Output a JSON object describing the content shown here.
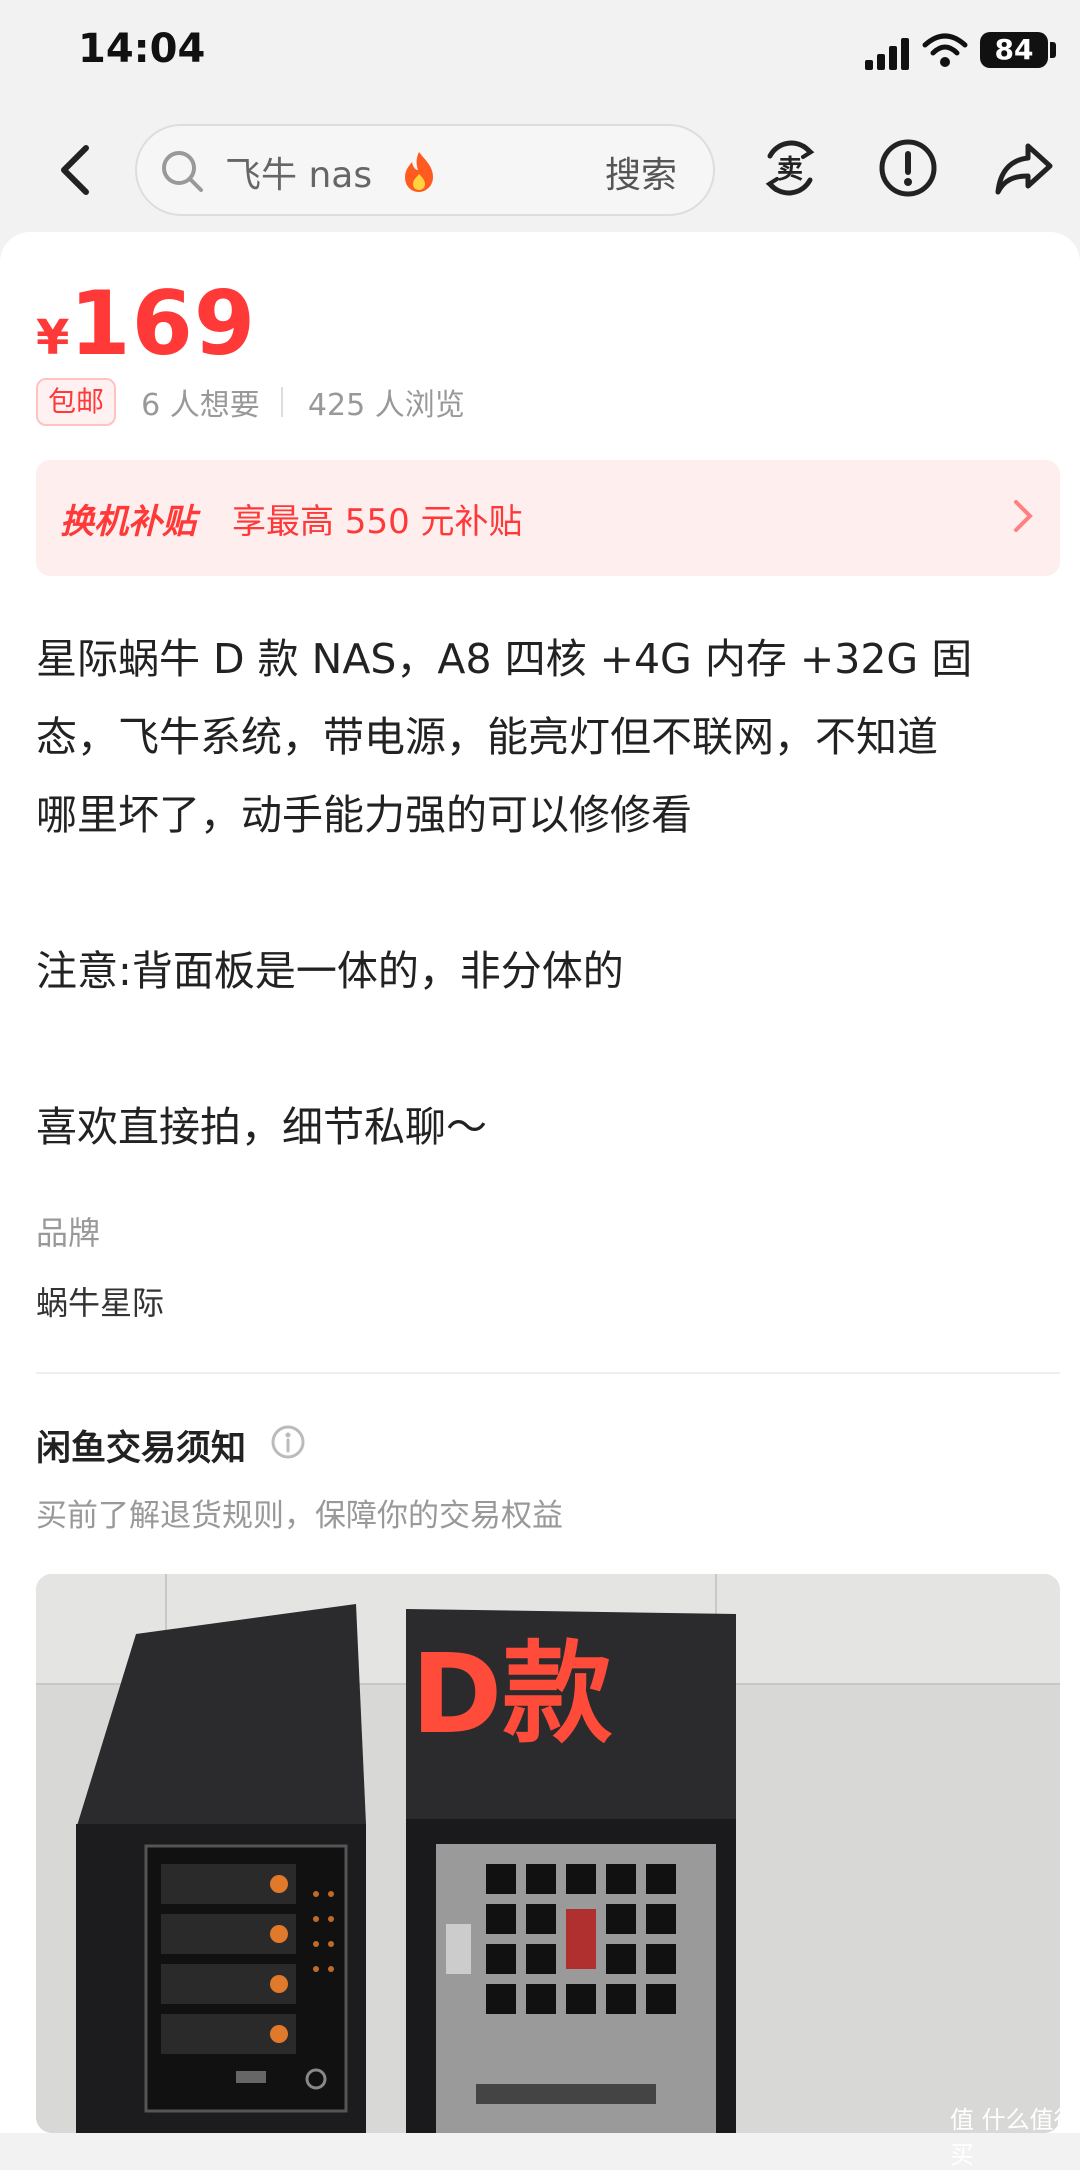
{
  "status_bar": {
    "time": "14:04",
    "battery": "84"
  },
  "nav": {
    "search_term": "飞牛 nas",
    "search_button": "搜索"
  },
  "price": {
    "symbol": "¥",
    "value": "169"
  },
  "meta": {
    "free_shipping": "包邮",
    "want": "6 人想要",
    "views": "425 人浏览"
  },
  "subsidy": {
    "title": "换机补贴",
    "text": "享最高 550 元补贴"
  },
  "description": "星际蜗牛 D 款 NAS，A8 四核 +4G 内存 +32G 固\n态，飞牛系统，带电源，能亮灯但不联网，不知道\n哪里坏了，动手能力强的可以修修看\n\n注意:背面板是一体的，非分体的\n\n喜欢直接拍，细节私聊～",
  "brand": {
    "label": "品牌",
    "value": "蜗牛星际"
  },
  "rules": {
    "title": "闲鱼交易须知",
    "subtitle": "买前了解退货规则，保障你的交易权益"
  },
  "photo": {
    "label": "D款"
  },
  "watermark": "值 什么值得买",
  "colors": {
    "accent": "#ff3838",
    "subsidy_bg": "#ffeeee"
  }
}
